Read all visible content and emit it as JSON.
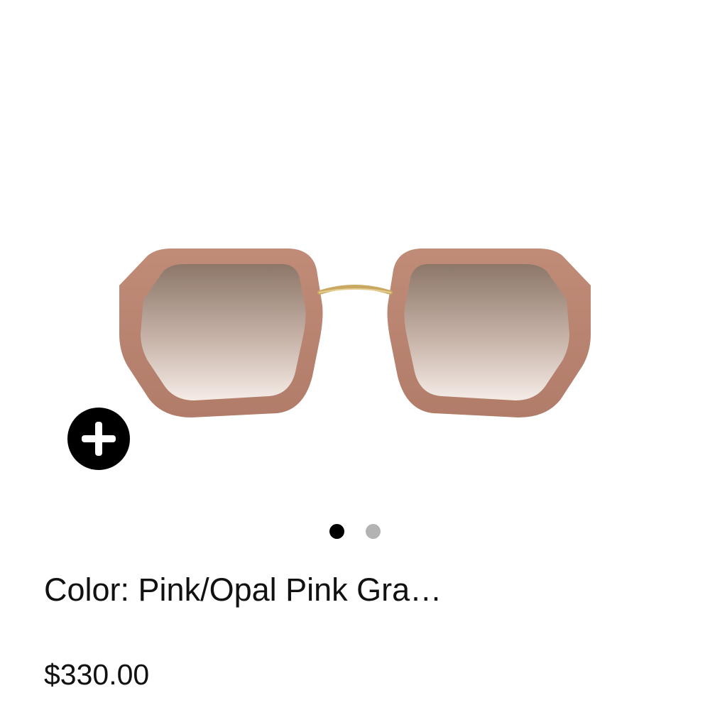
{
  "product": {
    "image_icon": "sunglasses-image",
    "color_label": "Color: Pink/Opal Pink Gra…",
    "price": "$330.00"
  },
  "actions": {
    "add_icon": "plus-icon"
  },
  "carousel": {
    "total": 2,
    "active_index": 0
  },
  "colors": {
    "frame": "#b98370",
    "lens_top": "#8c7769",
    "lens_bottom": "#f2e8e3",
    "bridge": "#c9a862",
    "dot_active": "#000000",
    "dot_inactive": "#b3b3b3"
  }
}
